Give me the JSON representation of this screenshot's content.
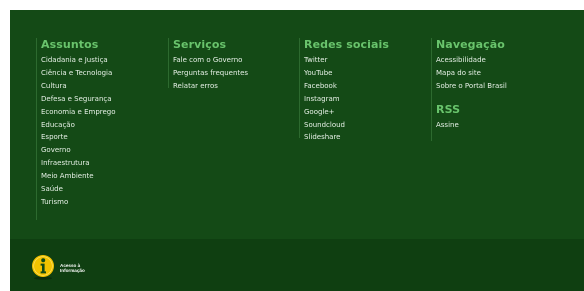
{
  "footer": {
    "assuntos": {
      "heading": "Assuntos",
      "items": [
        "Cidadania e Justiça",
        "Ciência e Tecnologia",
        "Cultura",
        "Defesa e Segurança",
        "Economia e Emprego",
        "Educação",
        "Esporte",
        "Governo",
        "Infraestrutura",
        "Meio Ambiente",
        "Saúde",
        "Turismo"
      ]
    },
    "servicos": {
      "heading": "Serviços",
      "items": [
        "Fale com o Governo",
        "Perguntas frequentes",
        "Relatar erros"
      ]
    },
    "redes": {
      "heading": "Redes sociais",
      "items": [
        "Twitter",
        "YouTube",
        "Facebook",
        "Instagram",
        "Google+",
        "Soundcloud",
        "Slideshare"
      ]
    },
    "navegacao": {
      "heading": "Navegação",
      "items": [
        "Acessibilidade",
        "Mapa do site",
        "Sobre o Portal Brasil"
      ]
    },
    "rss": {
      "heading": "RSS",
      "items": [
        "Assine"
      ]
    },
    "bottom": {
      "logo": {
        "line1": "Acesso à",
        "line2": "Informação",
        "icon": "information-icon"
      }
    }
  },
  "colors": {
    "footer_bg": "#144a16",
    "bottom_bg": "#0f3f11",
    "heading": "#69c46c",
    "link": "#e8f2e8",
    "logo_yellow": "#f3c300"
  }
}
